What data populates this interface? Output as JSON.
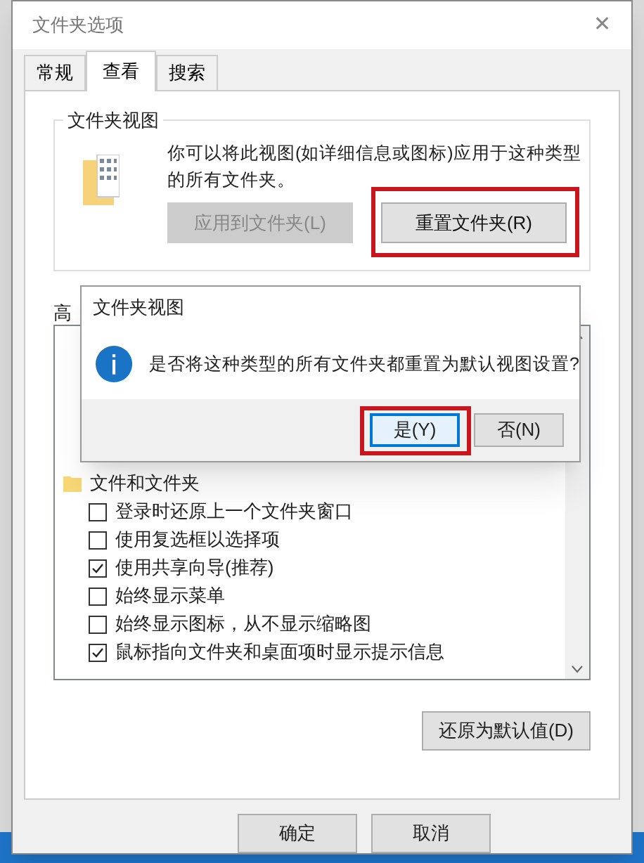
{
  "window": {
    "title": "文件夹选项",
    "close": "✕"
  },
  "tabs": [
    {
      "label": "常规",
      "selected": false
    },
    {
      "label": "查看",
      "selected": true
    },
    {
      "label": "搜索",
      "selected": false
    }
  ],
  "folder_views": {
    "title": "文件夹视图",
    "description": "你可以将此视图(如详细信息或图标)应用于这种类型的所有文件夹。",
    "buttons": [
      {
        "label": "应用到文件夹(L)",
        "disabled": true,
        "highlighted": false
      },
      {
        "label": "重置文件夹(R)",
        "disabled": false,
        "highlighted": true
      }
    ]
  },
  "advanced": {
    "label": "高",
    "items": [
      {
        "kind": "folder",
        "label": "文件和文件夹"
      },
      {
        "kind": "checkbox",
        "label": "登录时还原上一个文件夹窗口",
        "checked": false
      },
      {
        "kind": "checkbox",
        "label": "使用复选框以选择项",
        "checked": false
      },
      {
        "kind": "checkbox",
        "label": "使用共享向导(推荐)",
        "checked": true
      },
      {
        "kind": "checkbox",
        "label": "始终显示菜单",
        "checked": false
      },
      {
        "kind": "checkbox",
        "label": "始终显示图标，从不显示缩略图",
        "checked": false
      },
      {
        "kind": "checkbox",
        "label": "鼠标指向文件夹和桌面项时显示提示信息",
        "checked": true
      }
    ]
  },
  "restore_button": "还原为默认值(D)",
  "footer_buttons": [
    "确定",
    "取消"
  ],
  "message_box": {
    "title": "文件夹视图",
    "message": "是否将这种类型的所有文件夹都重置为默认视图设置?",
    "buttons": [
      {
        "label": "是(Y)",
        "default": true,
        "highlighted": true
      },
      {
        "label": "否(N)",
        "default": false,
        "highlighted": false
      }
    ]
  }
}
